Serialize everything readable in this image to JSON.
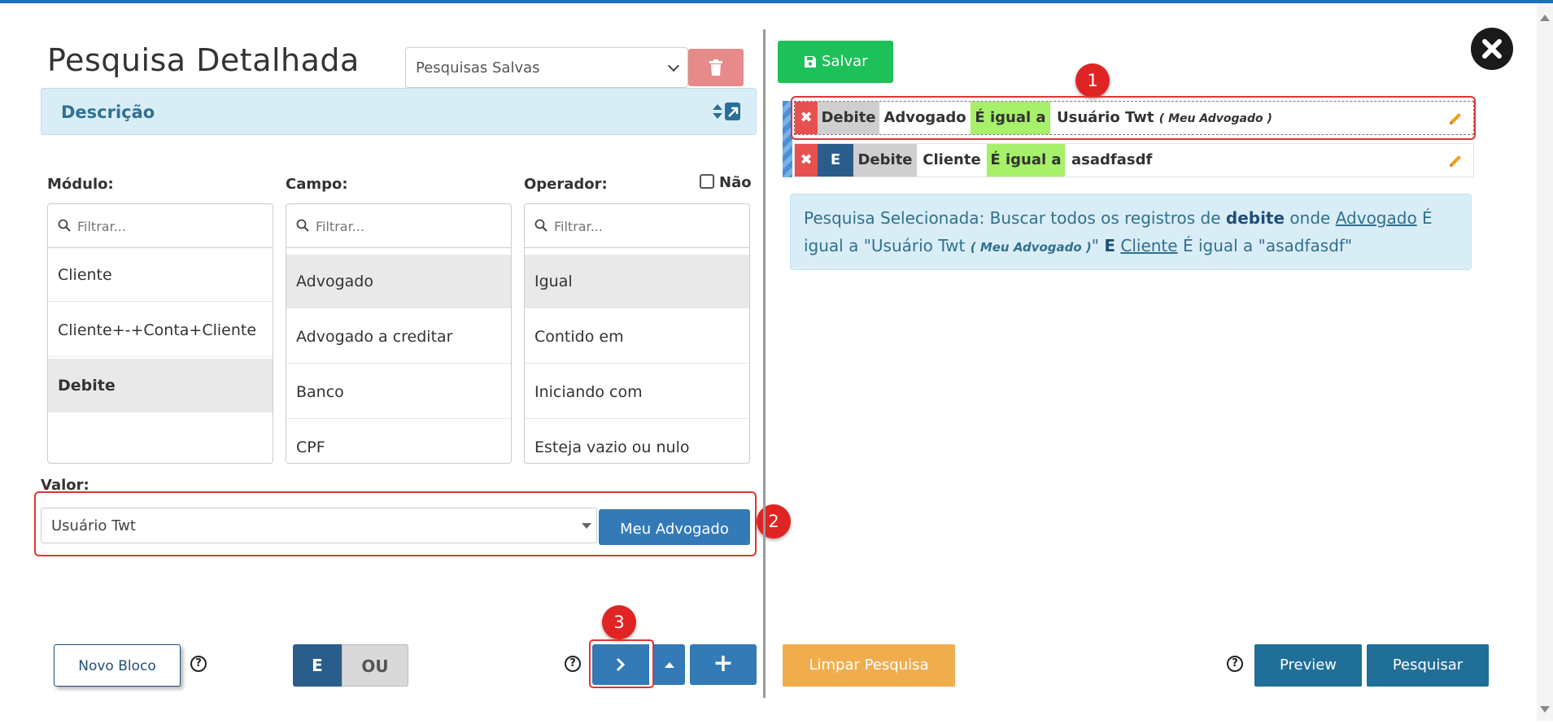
{
  "header": {
    "title": "Pesquisa Detalhada",
    "saved_searches_placeholder": "Pesquisas Salvas"
  },
  "description": {
    "label": "Descrição"
  },
  "columns": {
    "modulo": {
      "label": "Módulo:",
      "filter_placeholder": "Filtrar...",
      "items": [
        "Cliente",
        "Cliente+-+Conta+Cliente",
        "Debite"
      ],
      "selected": "Debite"
    },
    "campo": {
      "label": "Campo:",
      "filter_placeholder": "Filtrar...",
      "items": [
        "Advogado",
        "Advogado a creditar",
        "Banco",
        "CPF"
      ],
      "selected": "Advogado"
    },
    "operador": {
      "label": "Operador:",
      "filter_placeholder": "Filtrar...",
      "items": [
        "Igual",
        "Contido em",
        "Iniciando com",
        "Esteja vazio ou nulo"
      ],
      "selected": "Igual"
    },
    "nao_label": "Não"
  },
  "valor": {
    "label": "Valor:",
    "selected": "Usuário Twt",
    "meu_button": "Meu Advogado"
  },
  "badges": [
    "1",
    "2",
    "3"
  ],
  "bottom_left": {
    "novo_bloco": "Novo Bloco",
    "help": "?",
    "e": "E",
    "ou": "OU",
    "plus": "+"
  },
  "right": {
    "salvar": "Salvar",
    "rows": [
      {
        "module": "Debite",
        "field": "Advogado",
        "operator": "É igual a",
        "value": "Usuário Twt",
        "value_note": "( Meu Advogado )"
      },
      {
        "connector": "E",
        "module": "Debite",
        "field": "Cliente",
        "operator": "É igual a",
        "value": "asadfasdf"
      }
    ],
    "summary": {
      "prefix": "Pesquisa Selecionada: Buscar todos os registros de ",
      "module": "debite",
      "onde": " onde ",
      "field1": "Advogado",
      "op1_pre": " É igual a \"Usuário Twt ",
      "note1": "( Meu Advogado )",
      "op1_post": "\" ",
      "connector": "E",
      "sp": " ",
      "field2": "Cliente",
      "op2": " É igual a \"asadfasdf\""
    },
    "limpar": "Limpar Pesquisa",
    "preview": "Preview",
    "pesquisar": "Pesquisar"
  },
  "icons": [
    "trash-icon",
    "resize-toggle-icon",
    "search-icon",
    "save-icon",
    "close-icon",
    "pencil-icon",
    "chevron-right-icon",
    "caret-up-icon"
  ],
  "colors": {
    "primary": "#337ab7",
    "success": "#1ec05a",
    "danger": "#e85050",
    "warning": "#f0ad4e",
    "info_bg": "#d9edf7",
    "operator_green": "#a6f06a",
    "annotation_red": "#e02424"
  }
}
